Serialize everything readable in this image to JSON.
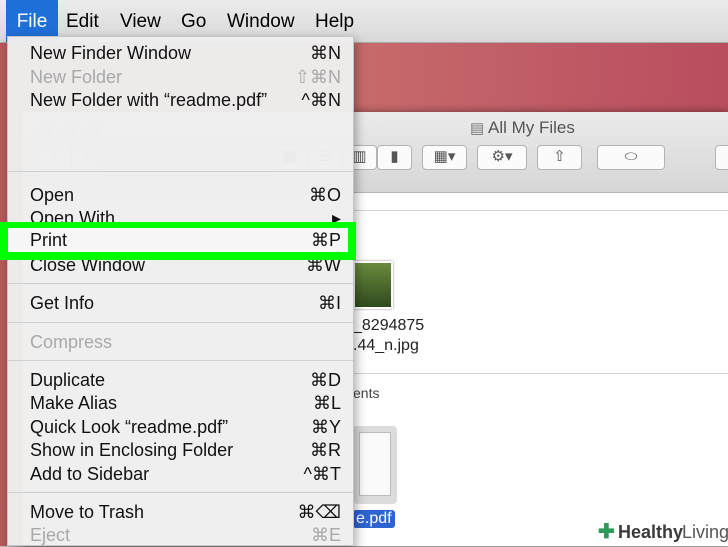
{
  "menubar": {
    "items": [
      "File",
      "Edit",
      "View",
      "Go",
      "Window",
      "Help"
    ]
  },
  "finder": {
    "title": "All My Files",
    "file1_line1": "_8294875",
    "file1_line2": ".44_n.jpg",
    "section_fragment": "ents",
    "file2_label": "e.pdf"
  },
  "menu": {
    "items": [
      {
        "label": "New Finder Window",
        "shortcut": "⌘N",
        "enabled": true
      },
      {
        "label": "New Folder",
        "shortcut": "⇧⌘N",
        "enabled": false
      },
      {
        "label": "New Folder with “readme.pdf”",
        "shortcut": "^⌘N",
        "enabled": true
      },
      {
        "label": "Open",
        "shortcut": "⌘O",
        "enabled": true
      },
      {
        "label": "Open With",
        "shortcut": "▸",
        "enabled": true
      },
      {
        "label": "Print",
        "shortcut": "⌘P",
        "enabled": true,
        "highlighted": true
      },
      {
        "label": "Close Window",
        "shortcut": "⌘W",
        "enabled": true
      },
      {
        "label": "Get Info",
        "shortcut": "⌘I",
        "enabled": true
      },
      {
        "label": "Compress",
        "shortcut": "",
        "enabled": false
      },
      {
        "label": "Duplicate",
        "shortcut": "⌘D",
        "enabled": true
      },
      {
        "label": "Make Alias",
        "shortcut": "⌘L",
        "enabled": true
      },
      {
        "label": "Quick Look “readme.pdf”",
        "shortcut": "⌘Y",
        "enabled": true
      },
      {
        "label": "Show in Enclosing Folder",
        "shortcut": "⌘R",
        "enabled": true
      },
      {
        "label": "Add to Sidebar",
        "shortcut": "^⌘T",
        "enabled": true
      },
      {
        "label": "Move to Trash",
        "shortcut": "⌘⌫",
        "enabled": true
      },
      {
        "label": "Eject",
        "shortcut": "⌘E",
        "enabled": false
      }
    ]
  },
  "watermark": {
    "brand": "Healthy",
    "suffix": "Living"
  },
  "colors": {
    "highlight": "#00ff00",
    "menubar_active": "#1f6fd8"
  }
}
